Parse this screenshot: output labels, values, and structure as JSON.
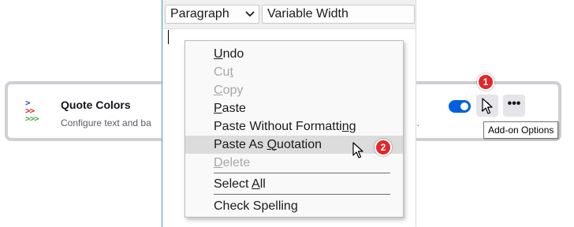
{
  "addon": {
    "name": "Quote Colors",
    "description": "Configure text and ba",
    "description_tail": "es.",
    "enabled": true,
    "toggle_color": "#0060df",
    "options_icon": "wrench-icon",
    "more_icon": "ellipsis-icon",
    "more_label": "•••",
    "icon_lines": [
      {
        "text": ">",
        "color": "#3b3fb6"
      },
      {
        "text": ">>",
        "color": "#d12a2a"
      },
      {
        "text": ">>>",
        "color": "#4fa64f"
      }
    ]
  },
  "tooltip": {
    "text": "Add-on Options"
  },
  "editor": {
    "paragraph_select": "Paragraph",
    "font_select": "Variable Width"
  },
  "context_menu": {
    "items": [
      {
        "pre": "",
        "key": "U",
        "post": "ndo",
        "disabled": false
      },
      {
        "pre": "Cu",
        "key": "t",
        "post": "",
        "disabled": true
      },
      {
        "pre": "",
        "key": "C",
        "post": "opy",
        "disabled": true
      },
      {
        "pre": "",
        "key": "P",
        "post": "aste",
        "disabled": false
      },
      {
        "pre": "Paste Without Formatti",
        "key": "n",
        "post": "g",
        "disabled": false
      },
      {
        "pre": "Paste As ",
        "key": "Q",
        "post": "uotation",
        "disabled": false,
        "highlighted": true
      },
      {
        "pre": "",
        "key": "D",
        "post": "elete",
        "disabled": true
      },
      {
        "pre": "Select ",
        "key": "A",
        "post": "ll",
        "disabled": false
      },
      {
        "pre": "Check Spellin",
        "key": "g",
        "post": "",
        "disabled": false
      }
    ],
    "highlight_color": "#dcdcdc"
  },
  "steps": [
    {
      "label": "1"
    },
    {
      "label": "2"
    }
  ],
  "colors": {
    "badge": "#e0282a",
    "accent_border": "#3aa6a3"
  }
}
